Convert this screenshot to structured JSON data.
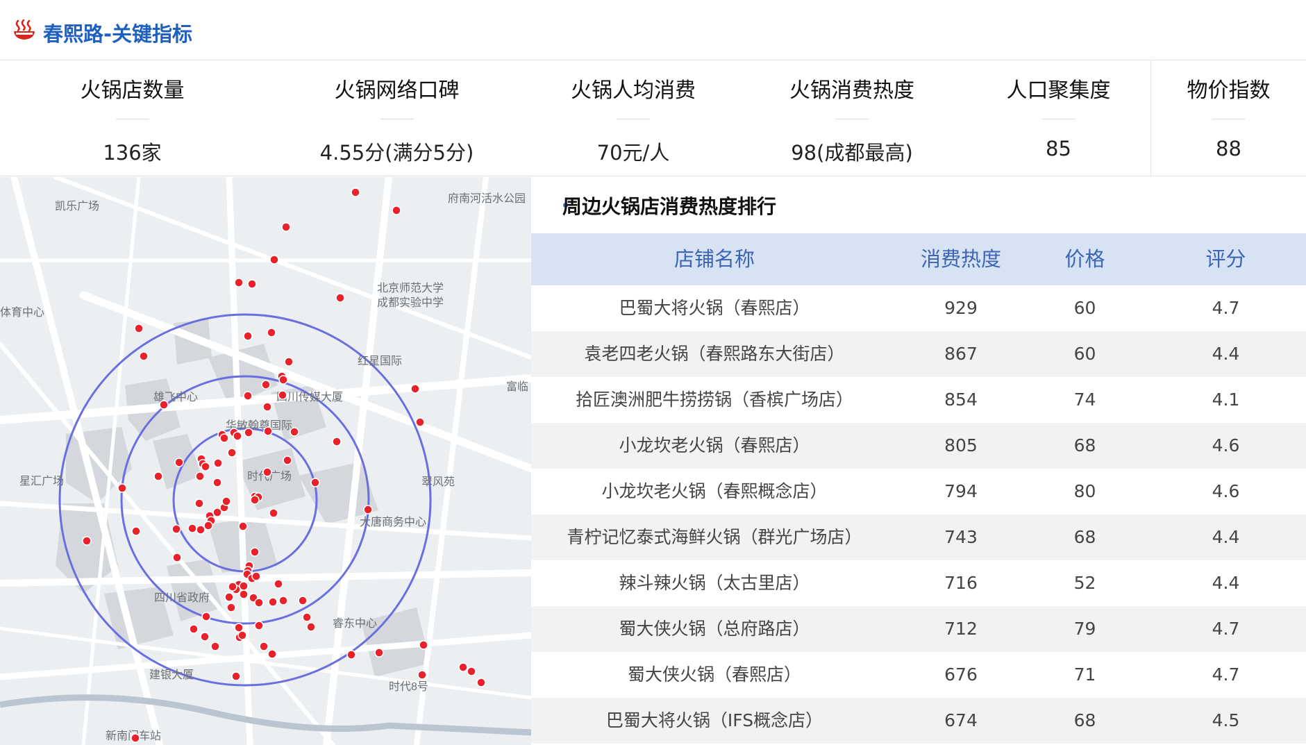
{
  "header": {
    "title": "春熙路-关键指标"
  },
  "kpis": [
    {
      "label": "火锅店数量",
      "value": "136家"
    },
    {
      "label": "火锅网络口碑",
      "value": "4.55分(满分5分)"
    },
    {
      "label": "火锅人均消费",
      "value": "70元/人"
    },
    {
      "label": "火锅消费热度",
      "value": "98(成都最高)"
    },
    {
      "label": "人口聚集度",
      "value": "85"
    },
    {
      "label": "物价指数",
      "value": "88"
    }
  ],
  "map": {
    "labels": [
      "凯乐广场",
      "府南河活水公园",
      "北京师范大学",
      "成都实验中学",
      "体育中心",
      "红星国际",
      "富临",
      "雄飞中心",
      "四川传媒大厦",
      "华敏翰尊国际",
      "星汇广场",
      "时代广场",
      "翠风苑",
      "大唐商务中心",
      "四川省政府",
      "睿东中心",
      "建银大厦",
      "时代8号",
      "新南门车站"
    ]
  },
  "ranking": {
    "heading": "周边火锅店消费热度排行",
    "columns": [
      "店铺名称",
      "消费热度",
      "价格",
      "评分"
    ],
    "rows": [
      [
        "巴蜀大将火锅（春熙店）",
        "929",
        "60",
        "4.7"
      ],
      [
        "袁老四老火锅（春熙路东大街店）",
        "867",
        "60",
        "4.4"
      ],
      [
        "拾匠澳洲肥牛捞捞锅（香槟广场店）",
        "854",
        "74",
        "4.1"
      ],
      [
        "小龙坎老火锅（春熙店）",
        "805",
        "68",
        "4.6"
      ],
      [
        "小龙坎老火锅（春熙概念店）",
        "794",
        "80",
        "4.6"
      ],
      [
        "青柠记忆泰式海鲜火锅（群光广场店）",
        "743",
        "68",
        "4.4"
      ],
      [
        "辣斗辣火锅（太古里店）",
        "716",
        "52",
        "4.4"
      ],
      [
        "蜀大侠火锅（总府路店）",
        "712",
        "79",
        "4.7"
      ],
      [
        "蜀大侠火锅（春熙店）",
        "676",
        "71",
        "4.7"
      ],
      [
        "巴蜀大将火锅（IFS概念店）",
        "674",
        "68",
        "4.5"
      ]
    ]
  },
  "colors": {
    "accent": "#1f5fbf",
    "header_row": "#d7e2f3",
    "ring": "#6a6fe0",
    "marker": "#e8212b",
    "logo": "#d8261d"
  }
}
